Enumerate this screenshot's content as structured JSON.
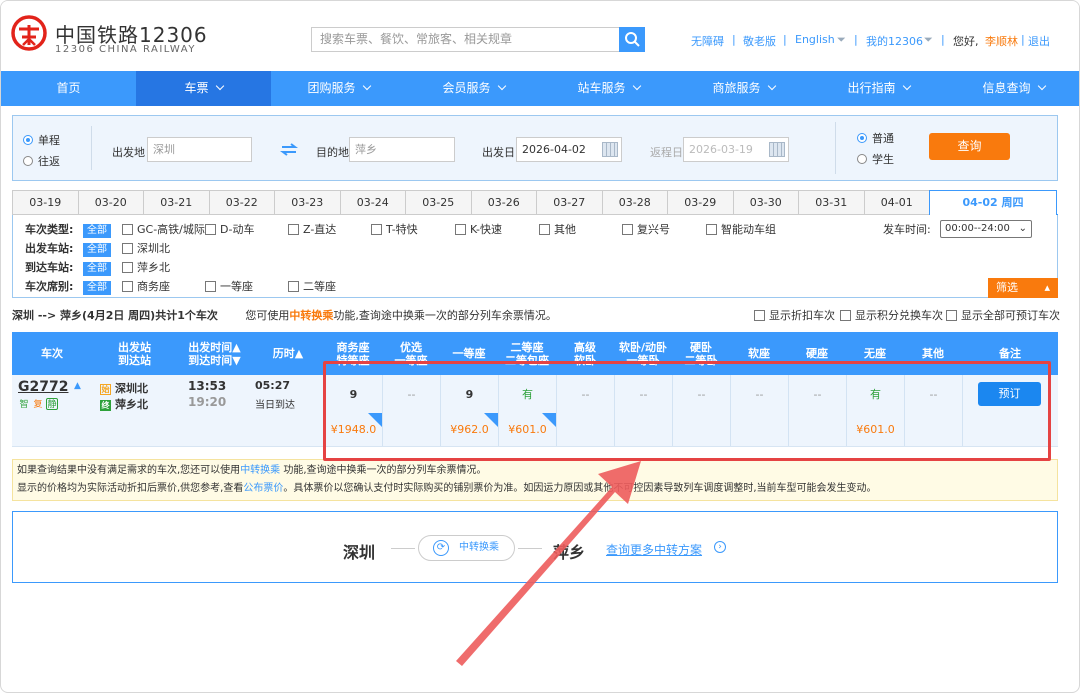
{
  "header": {
    "logo_cn": "中国铁路12306",
    "logo_en": "12306 CHINA RAILWAY",
    "search_placeholder": "搜索车票、餐饮、常旅客、相关规章",
    "links": [
      "无障碍",
      "敬老版",
      "English",
      "我的12306"
    ],
    "greeting": "您好,",
    "user": "李顺林",
    "logout": "退出"
  },
  "nav": [
    "首页",
    "车票",
    "团购服务",
    "会员服务",
    "站车服务",
    "商旅服务",
    "出行指南",
    "信息查询"
  ],
  "query": {
    "oneway": "单程",
    "roundtrip": "往返",
    "from_label": "出发地",
    "from_value": "深圳",
    "to_label": "目的地",
    "to_value": "萍乡",
    "date_label": "出发日",
    "date_value": "2026-04-02",
    "return_label": "返程日",
    "return_value": "2026-03-19",
    "normal": "普通",
    "student": "学生",
    "button": "查询"
  },
  "dates": [
    "03-19",
    "03-20",
    "03-21",
    "03-22",
    "03-23",
    "03-24",
    "03-25",
    "03-26",
    "03-27",
    "03-28",
    "03-29",
    "03-30",
    "03-31",
    "04-01",
    "04-02 周四"
  ],
  "filter": {
    "type_label": "车次类型:",
    "all": "全部",
    "types": [
      "GC-高铁/城际",
      "D-动车",
      "Z-直达",
      "T-特快",
      "K-快速",
      "其他",
      "复兴号",
      "智能动车组"
    ],
    "depart_time_label": "发车时间:",
    "depart_time_value": "00:00--24:00",
    "from_station_label": "出发车站:",
    "from_stations": [
      "深圳北"
    ],
    "to_station_label": "到达车站:",
    "to_stations": [
      "萍乡北"
    ],
    "seat_label": "车次席别:",
    "seats": [
      "商务座",
      "一等座",
      "二等座"
    ],
    "screen_btn": "筛选"
  },
  "summary": {
    "route": "深圳 --> 萍乡(4月2日 周四)共计1个车次",
    "tip_prefix": "您可使用",
    "tip_link": "中转换乘",
    "tip_suffix": "功能,查询途中换乘一次的部分列车余票情况。",
    "options": [
      "显示折扣车次",
      "显示积分兑换车次",
      "显示全部可预订车次"
    ]
  },
  "table": {
    "headers": [
      "车次",
      "出发站\n到达站",
      "出发时间▲\n到达时间▼",
      "历时▲",
      "商务座\n特等座",
      "优选\n一等座",
      "一等座",
      "二等座\n二等包座",
      "高级\n软卧",
      "软卧/动卧\n一等卧",
      "硬卧\n二等卧",
      "软座",
      "硬座",
      "无座",
      "其他",
      "备注"
    ],
    "train": {
      "no": "G2772",
      "tags": [
        "智",
        "复",
        "静"
      ],
      "from": "深圳北",
      "to": "萍乡北",
      "depart": "13:53",
      "arrive": "19:20",
      "duration": "05:27",
      "arrive_day": "当日到达",
      "seats": [
        "9",
        "--",
        "9",
        "有",
        "--",
        "--",
        "--",
        "--",
        "--",
        "有",
        "--"
      ],
      "prices": [
        "¥1948.0",
        "",
        "¥962.0",
        "¥601.0",
        "",
        "",
        "",
        "",
        "",
        "¥601.0",
        ""
      ],
      "book": "预订"
    }
  },
  "note": {
    "line1_a": "如果查询结果中没有满足需求的车次,您还可以使用",
    "line1_link": "中转换乘",
    "line1_b": " 功能,查询途中换乘一次的部分列车余票情况。",
    "line2_a": "显示的价格均为实际活动折扣后票价,供您参考,查看",
    "line2_link": "公布票价",
    "line2_b": "。具体票价以您确认支付时实际购买的铺别票价为准。如因运力原因或其他不可控因素导致列车调度调整时,当前车型可能会发生变动。"
  },
  "transfer": {
    "from": "深圳",
    "btn": "中转换乘",
    "to": "萍乡",
    "more": "查询更多中转方案"
  }
}
